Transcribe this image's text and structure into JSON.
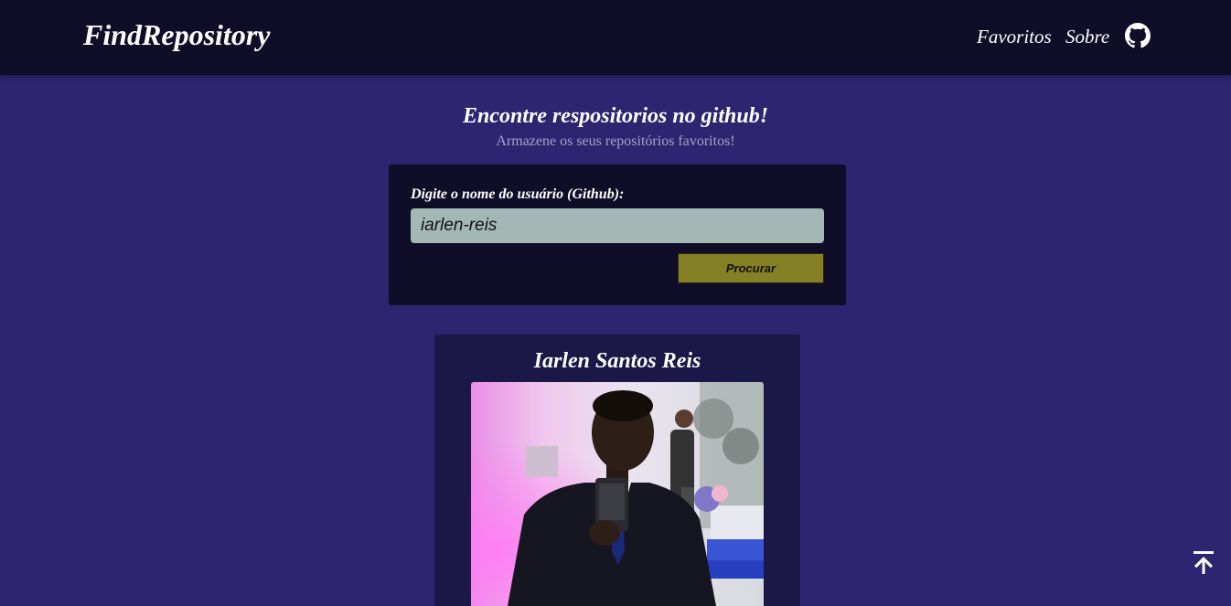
{
  "navbar": {
    "brand": "FindRepository",
    "links": {
      "favorites": "Favoritos",
      "about": "Sobre"
    },
    "github_icon": "github-icon"
  },
  "hero": {
    "title": "Encontre respositorios no github!",
    "subtitle": "Armazene os seus repositórios favoritos!"
  },
  "search": {
    "label": "Digite o nome do usuário (Github):",
    "value": "iarlen-reis",
    "button_label": "Procurar"
  },
  "profile": {
    "name": "Iarlen Santos Reis",
    "avatar": "user-avatar-photo"
  },
  "scroll_top": {
    "icon": "arrow-up-to-top-icon"
  },
  "colors": {
    "background": "#2d2570",
    "navbar": "#0f0d28",
    "card": "#0f0d28",
    "profile_card": "#1b1848",
    "input_bg": "#a3b8b4",
    "button": "#857f25",
    "subtitle": "#a7a2c6"
  }
}
